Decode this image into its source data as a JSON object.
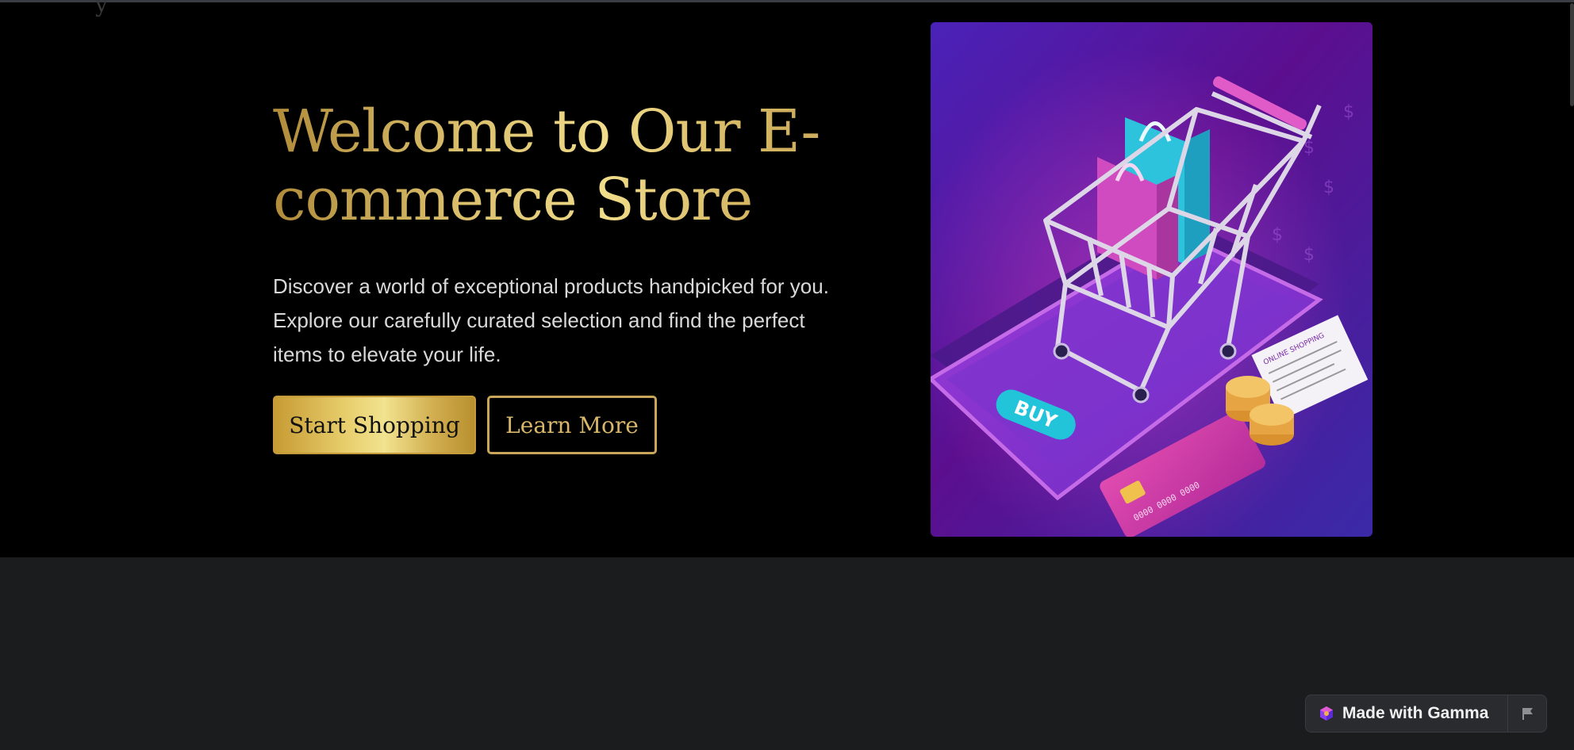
{
  "hero": {
    "title": "Welcome to Our E-commerce Store",
    "description": "Discover a world of exceptional products handpicked for you. Explore our carefully curated selection and find the perfect items to elevate your life.",
    "primary_button": "Start Shopping",
    "secondary_button": "Learn More",
    "image": {
      "buy_label": "BUY",
      "card_number": "0000 0000 0000",
      "receipt_title": "ONLINE SHOPPING"
    }
  },
  "badge": {
    "label": "Made with Gamma",
    "logo_icon": "gamma-logo-icon",
    "flag_icon": "flag-icon"
  },
  "colors": {
    "gold_light": "#f0dc8a",
    "gold_dark": "#b08b3a",
    "purple_bg": "#5a1fa8",
    "page_bg": "#1b1c1e"
  }
}
